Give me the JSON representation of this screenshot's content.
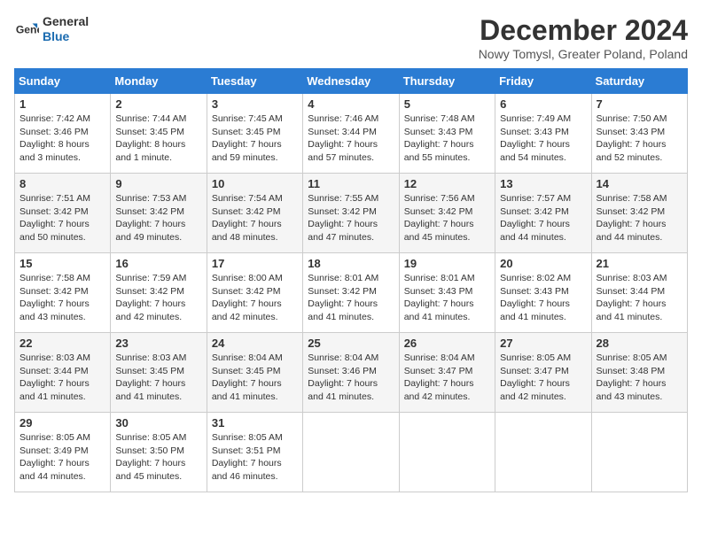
{
  "logo": {
    "line1": "General",
    "line2": "Blue"
  },
  "title": "December 2024",
  "subtitle": "Nowy Tomysl, Greater Poland, Poland",
  "weekdays": [
    "Sunday",
    "Monday",
    "Tuesday",
    "Wednesday",
    "Thursday",
    "Friday",
    "Saturday"
  ],
  "weeks": [
    [
      {
        "day": "1",
        "sunrise": "Sunrise: 7:42 AM",
        "sunset": "Sunset: 3:46 PM",
        "daylight": "Daylight: 8 hours and 3 minutes."
      },
      {
        "day": "2",
        "sunrise": "Sunrise: 7:44 AM",
        "sunset": "Sunset: 3:45 PM",
        "daylight": "Daylight: 8 hours and 1 minute."
      },
      {
        "day": "3",
        "sunrise": "Sunrise: 7:45 AM",
        "sunset": "Sunset: 3:45 PM",
        "daylight": "Daylight: 7 hours and 59 minutes."
      },
      {
        "day": "4",
        "sunrise": "Sunrise: 7:46 AM",
        "sunset": "Sunset: 3:44 PM",
        "daylight": "Daylight: 7 hours and 57 minutes."
      },
      {
        "day": "5",
        "sunrise": "Sunrise: 7:48 AM",
        "sunset": "Sunset: 3:43 PM",
        "daylight": "Daylight: 7 hours and 55 minutes."
      },
      {
        "day": "6",
        "sunrise": "Sunrise: 7:49 AM",
        "sunset": "Sunset: 3:43 PM",
        "daylight": "Daylight: 7 hours and 54 minutes."
      },
      {
        "day": "7",
        "sunrise": "Sunrise: 7:50 AM",
        "sunset": "Sunset: 3:43 PM",
        "daylight": "Daylight: 7 hours and 52 minutes."
      }
    ],
    [
      {
        "day": "8",
        "sunrise": "Sunrise: 7:51 AM",
        "sunset": "Sunset: 3:42 PM",
        "daylight": "Daylight: 7 hours and 50 minutes."
      },
      {
        "day": "9",
        "sunrise": "Sunrise: 7:53 AM",
        "sunset": "Sunset: 3:42 PM",
        "daylight": "Daylight: 7 hours and 49 minutes."
      },
      {
        "day": "10",
        "sunrise": "Sunrise: 7:54 AM",
        "sunset": "Sunset: 3:42 PM",
        "daylight": "Daylight: 7 hours and 48 minutes."
      },
      {
        "day": "11",
        "sunrise": "Sunrise: 7:55 AM",
        "sunset": "Sunset: 3:42 PM",
        "daylight": "Daylight: 7 hours and 47 minutes."
      },
      {
        "day": "12",
        "sunrise": "Sunrise: 7:56 AM",
        "sunset": "Sunset: 3:42 PM",
        "daylight": "Daylight: 7 hours and 45 minutes."
      },
      {
        "day": "13",
        "sunrise": "Sunrise: 7:57 AM",
        "sunset": "Sunset: 3:42 PM",
        "daylight": "Daylight: 7 hours and 44 minutes."
      },
      {
        "day": "14",
        "sunrise": "Sunrise: 7:58 AM",
        "sunset": "Sunset: 3:42 PM",
        "daylight": "Daylight: 7 hours and 44 minutes."
      }
    ],
    [
      {
        "day": "15",
        "sunrise": "Sunrise: 7:58 AM",
        "sunset": "Sunset: 3:42 PM",
        "daylight": "Daylight: 7 hours and 43 minutes."
      },
      {
        "day": "16",
        "sunrise": "Sunrise: 7:59 AM",
        "sunset": "Sunset: 3:42 PM",
        "daylight": "Daylight: 7 hours and 42 minutes."
      },
      {
        "day": "17",
        "sunrise": "Sunrise: 8:00 AM",
        "sunset": "Sunset: 3:42 PM",
        "daylight": "Daylight: 7 hours and 42 minutes."
      },
      {
        "day": "18",
        "sunrise": "Sunrise: 8:01 AM",
        "sunset": "Sunset: 3:42 PM",
        "daylight": "Daylight: 7 hours and 41 minutes."
      },
      {
        "day": "19",
        "sunrise": "Sunrise: 8:01 AM",
        "sunset": "Sunset: 3:43 PM",
        "daylight": "Daylight: 7 hours and 41 minutes."
      },
      {
        "day": "20",
        "sunrise": "Sunrise: 8:02 AM",
        "sunset": "Sunset: 3:43 PM",
        "daylight": "Daylight: 7 hours and 41 minutes."
      },
      {
        "day": "21",
        "sunrise": "Sunrise: 8:03 AM",
        "sunset": "Sunset: 3:44 PM",
        "daylight": "Daylight: 7 hours and 41 minutes."
      }
    ],
    [
      {
        "day": "22",
        "sunrise": "Sunrise: 8:03 AM",
        "sunset": "Sunset: 3:44 PM",
        "daylight": "Daylight: 7 hours and 41 minutes."
      },
      {
        "day": "23",
        "sunrise": "Sunrise: 8:03 AM",
        "sunset": "Sunset: 3:45 PM",
        "daylight": "Daylight: 7 hours and 41 minutes."
      },
      {
        "day": "24",
        "sunrise": "Sunrise: 8:04 AM",
        "sunset": "Sunset: 3:45 PM",
        "daylight": "Daylight: 7 hours and 41 minutes."
      },
      {
        "day": "25",
        "sunrise": "Sunrise: 8:04 AM",
        "sunset": "Sunset: 3:46 PM",
        "daylight": "Daylight: 7 hours and 41 minutes."
      },
      {
        "day": "26",
        "sunrise": "Sunrise: 8:04 AM",
        "sunset": "Sunset: 3:47 PM",
        "daylight": "Daylight: 7 hours and 42 minutes."
      },
      {
        "day": "27",
        "sunrise": "Sunrise: 8:05 AM",
        "sunset": "Sunset: 3:47 PM",
        "daylight": "Daylight: 7 hours and 42 minutes."
      },
      {
        "day": "28",
        "sunrise": "Sunrise: 8:05 AM",
        "sunset": "Sunset: 3:48 PM",
        "daylight": "Daylight: 7 hours and 43 minutes."
      }
    ],
    [
      {
        "day": "29",
        "sunrise": "Sunrise: 8:05 AM",
        "sunset": "Sunset: 3:49 PM",
        "daylight": "Daylight: 7 hours and 44 minutes."
      },
      {
        "day": "30",
        "sunrise": "Sunrise: 8:05 AM",
        "sunset": "Sunset: 3:50 PM",
        "daylight": "Daylight: 7 hours and 45 minutes."
      },
      {
        "day": "31",
        "sunrise": "Sunrise: 8:05 AM",
        "sunset": "Sunset: 3:51 PM",
        "daylight": "Daylight: 7 hours and 46 minutes."
      },
      null,
      null,
      null,
      null
    ]
  ]
}
